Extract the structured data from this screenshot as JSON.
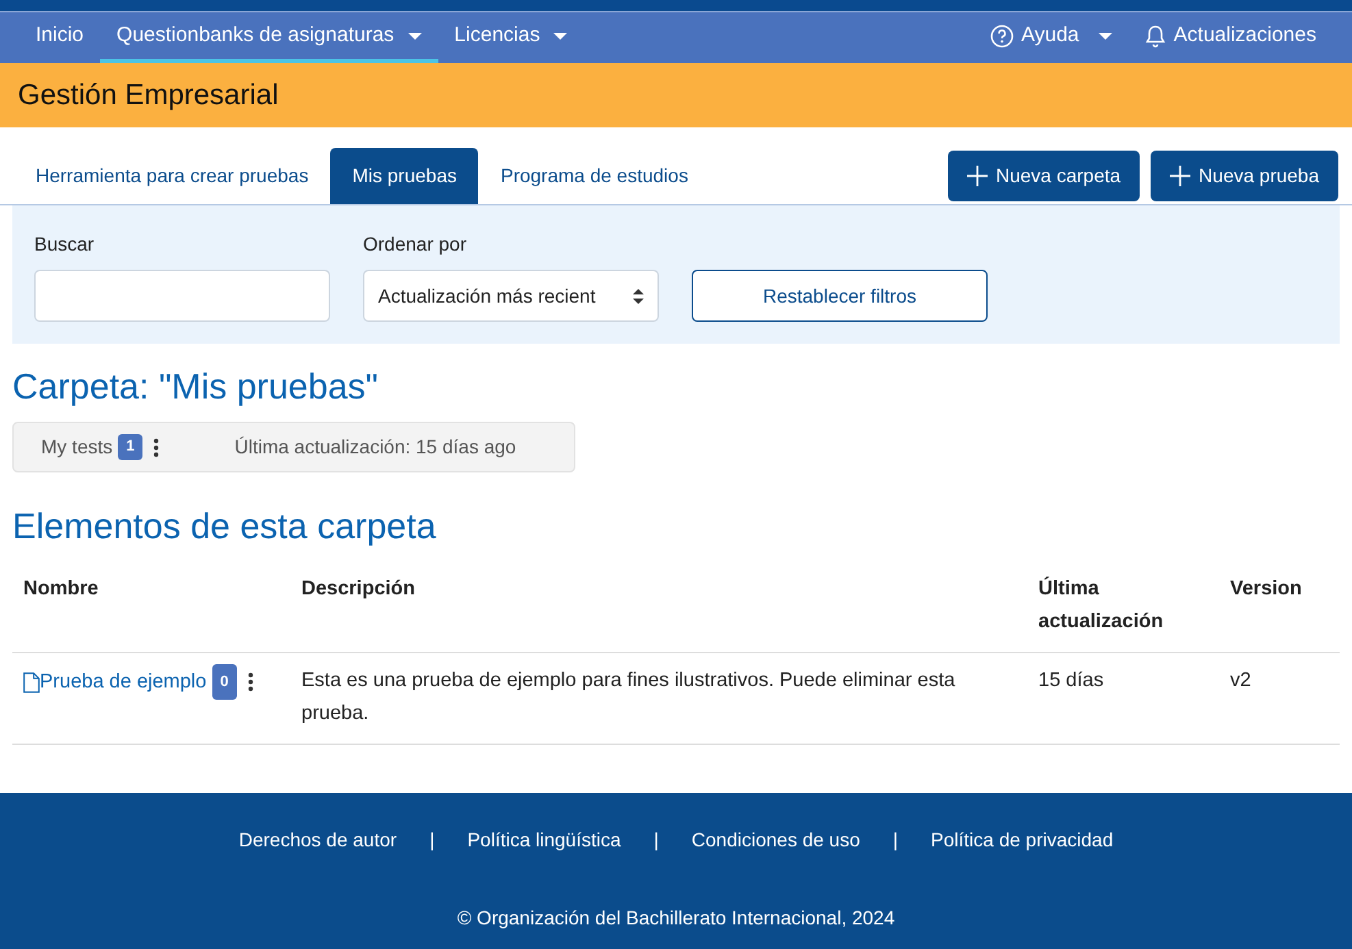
{
  "navbar": {
    "items": [
      {
        "label": "Inicio",
        "selected": false,
        "dropdown": false
      },
      {
        "label": "Questionbanks de asignaturas",
        "selected": true,
        "dropdown": true
      },
      {
        "label": "Licencias",
        "selected": false,
        "dropdown": true
      }
    ],
    "right_items": [
      {
        "label": "Ayuda",
        "kind": "help"
      },
      {
        "label": "Actualizaciones",
        "kind": "bell"
      }
    ]
  },
  "subject_title": "Gestión Empresarial",
  "tabs": [
    {
      "label": "Herramienta para crear pruebas",
      "selected": false
    },
    {
      "label": "Mis pruebas",
      "selected": true
    },
    {
      "label": "Programa de estudios",
      "selected": false
    }
  ],
  "action_buttons": [
    "Nueva carpeta",
    "Nueva prueba"
  ],
  "filters": {
    "search_label": "Buscar",
    "sort_label": "Ordenar por",
    "sort_value": "Actualización más recient",
    "reset_button": "Restablecer filtros"
  },
  "folder_heading": "Carpeta: \"Mis pruebas\"",
  "folder_bar": {
    "name": "My tests",
    "count": "1",
    "updated": "Última actualización: 15 días ago"
  },
  "items_heading": "Elementos de esta carpeta",
  "table": {
    "columns": [
      "Nombre",
      "Descripción",
      "Última actualización",
      "Version"
    ],
    "rows": [
      {
        "name": "Prueba de ejemplo",
        "count": "0",
        "description": "Esta es una prueba de ejemplo para fines ilustrativos. Puede eliminar esta prueba.",
        "updated": "15 días",
        "version": "v2"
      }
    ]
  },
  "footer": {
    "links": [
      "Derechos de autor",
      "Política lingüística",
      "Condiciones de uso",
      "Política de privacidad"
    ],
    "separator": "|",
    "copyright": "© Organización del Bachillerato Internacional, 2024"
  }
}
